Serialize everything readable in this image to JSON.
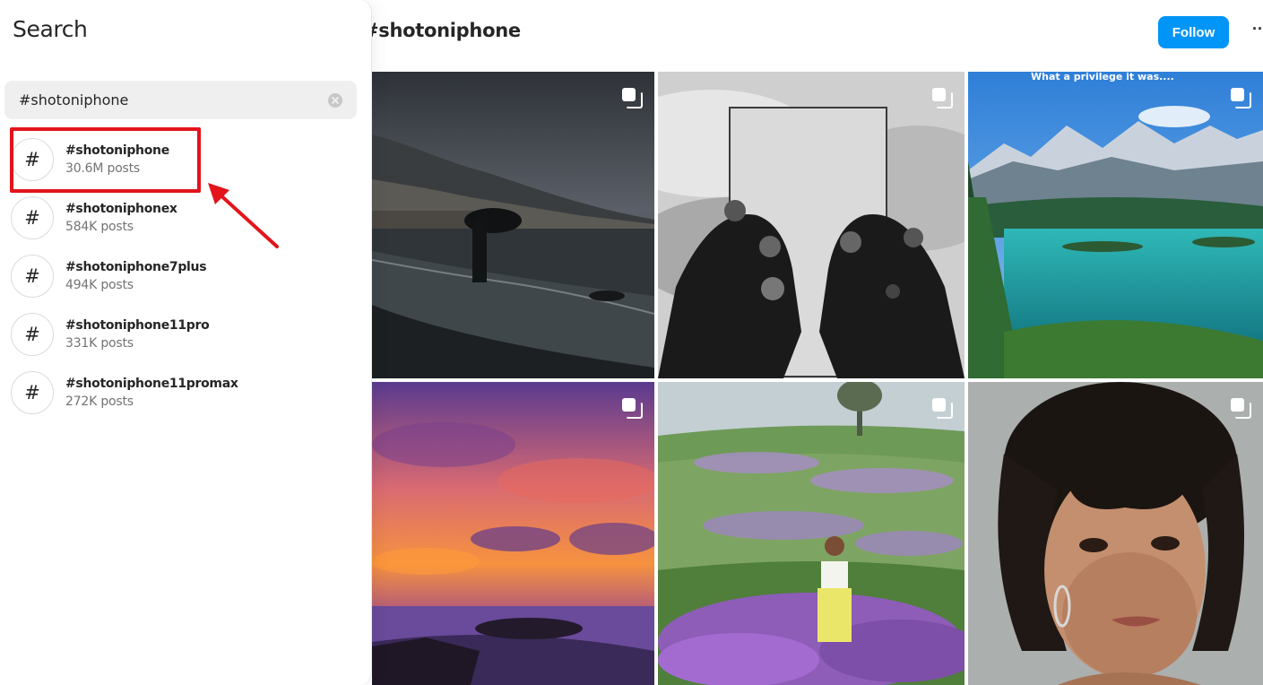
{
  "search_panel": {
    "title": "Search",
    "query": "#shotoniphone",
    "results": [
      {
        "name": "#shotoniphone",
        "count": "30.6M posts"
      },
      {
        "name": "#shotoniphonex",
        "count": "584K posts"
      },
      {
        "name": "#shotoniphone7plus",
        "count": "494K posts"
      },
      {
        "name": "#shotoniphone11pro",
        "count": "331K posts"
      },
      {
        "name": "#shotoniphone11promax",
        "count": "272K posts"
      }
    ],
    "result_icon": "hashtag-icon",
    "annotation_color": "#e3141b"
  },
  "header": {
    "title": "#shotoniphone",
    "follow_label": "Follow",
    "more_label": "···",
    "accent_color": "#0095f6"
  },
  "grid": {
    "posts": [
      {
        "subject": "coastal town at dusk",
        "multi": true
      },
      {
        "subject": "hands holding glass",
        "multi": true
      },
      {
        "subject": "mountain lake",
        "multi": true,
        "caption": "What a privilege it was...."
      },
      {
        "subject": "purple sunset over sea",
        "multi": true
      },
      {
        "subject": "woman in flower field",
        "multi": true
      },
      {
        "subject": "portrait",
        "multi": true
      }
    ]
  }
}
